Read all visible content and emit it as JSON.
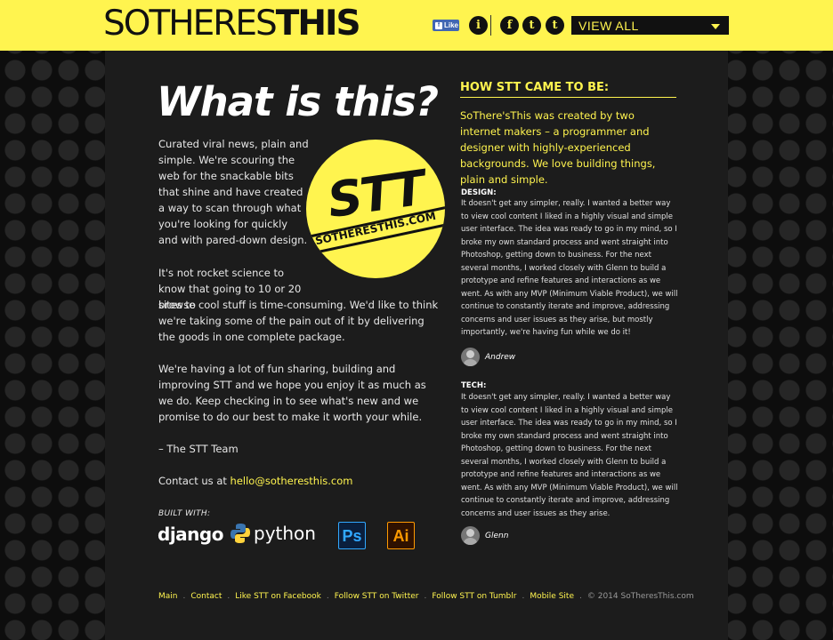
{
  "header": {
    "logo_thin": "SOTHERES",
    "logo_bold": "THIS",
    "fb_like": "Like",
    "icons": [
      "info-icon",
      "facebook-icon",
      "twitter-icon",
      "tumblr-icon"
    ],
    "icon_glyphs": {
      "info": "i",
      "facebook": "f",
      "twitter": "t",
      "tumblr": "t"
    },
    "view_all": "VIEW ALL",
    "accent_color": "#fff44f"
  },
  "main": {
    "title": "What is this?",
    "p1": "Curated viral news, plain and simple. We're scouring the web for the snackable bits that shine and have created a way to scan through what you're looking for quickly and with pared-down design.",
    "p2a": "It's not rocket science to know that going to 10 or 20 sites to",
    "p2b": "browse cool stuff is time-consuming. We'd like to think we're taking some of the pain out of it by delivering the goods in one complete package.",
    "p3": "We're having a lot of fun sharing, building and improving STT and we hope you enjoy it as much as we do. Keep checking in to see what's new and we promise to do our best to make it worth your while.",
    "signoff": "– The STT Team",
    "contact_prefix": "Contact us at ",
    "contact_email": "hello@sotheresthis.com",
    "badge_big": "STT",
    "badge_small": "SOTHERESTHIS.COM",
    "built_with_label": "BUILT WITH:",
    "built_with": {
      "django": "django",
      "python": "python",
      "ps": "Ps",
      "ai": "Ai"
    }
  },
  "side": {
    "heading": "HOW STT CAME TO BE:",
    "intro": "SoThere'sThis was created by two internet makers – a programmer and designer with highly-experienced backgrounds. We love building things, plain and simple.",
    "design_label": "DESIGN:",
    "design_text": "It doesn't get any simpler, really. I wanted a better way to view cool content I liked in a highly visual and simple user interface. The idea was ready to go in my mind, so I broke my own standard process and went straight into Photoshop, getting down to business. For the next several months, I worked closely with Glenn to build a prototype and refine features and interactions as we went. As with any MVP (Minimum Viable Product), we will continue to constantly iterate and improve, addressing concerns and user issues as they arise, but mostly importantly, we're having fun while we do it!",
    "design_author": "Andrew",
    "tech_label": "TECH:",
    "tech_text": "It doesn't get any simpler, really. I wanted a better way to view cool content I liked in a highly visual and simple user interface. The idea was ready to go in my mind, so I broke my own standard process and went straight into Photoshop, getting down to business. For the next several months, I worked closely with Glenn to build a prototype and refine features and interactions as we went. As with any MVP (Minimum Viable Product), we will continue to constantly iterate and improve, addressing concerns and user issues as they arise.",
    "tech_author": "Glenn"
  },
  "footer": {
    "links": [
      "Main",
      "Contact",
      "Like STT on Facebook",
      "Follow STT on Twitter",
      "Follow STT on Tumblr",
      "Mobile Site"
    ],
    "copyright": "© 2014 SoTheresThis.com"
  }
}
